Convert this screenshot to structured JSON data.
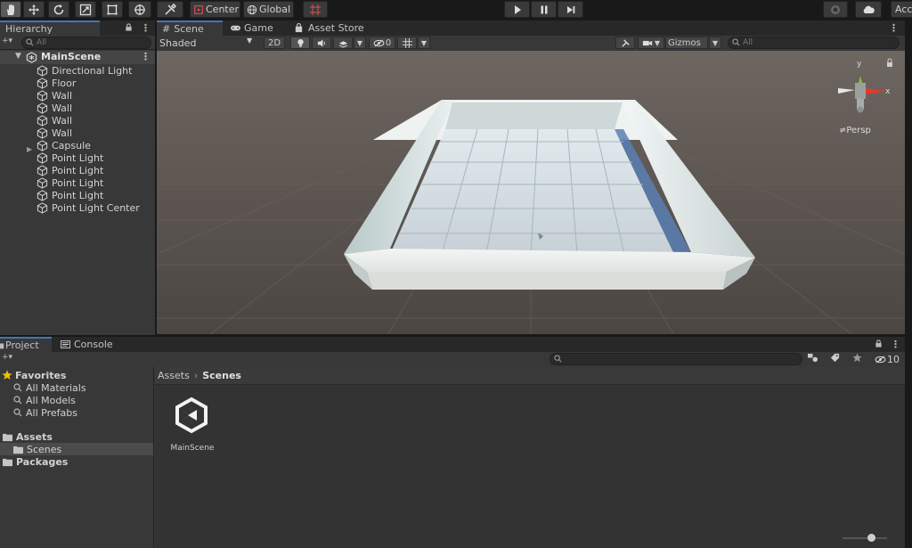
{
  "toolbar": {
    "center_label": "Center",
    "global_label": "Global",
    "account_label": "Acc"
  },
  "hierarchy": {
    "tab_label": "Hierarchy",
    "search_placeholder": "All",
    "scene_name": "MainScene",
    "items": [
      {
        "label": "Directional Light"
      },
      {
        "label": "Floor"
      },
      {
        "label": "Wall"
      },
      {
        "label": "Wall"
      },
      {
        "label": "Wall"
      },
      {
        "label": "Wall"
      },
      {
        "label": "Capsule"
      },
      {
        "label": "Point Light"
      },
      {
        "label": "Point Light"
      },
      {
        "label": "Point Light"
      },
      {
        "label": "Point Light"
      },
      {
        "label": "Point Light Center"
      }
    ]
  },
  "scene_tabs": {
    "scene": "Scene",
    "game": "Game",
    "asset_store": "Asset Store"
  },
  "scene_toolbar": {
    "shading_mode": "Shaded",
    "mode_2d": "2D",
    "hidden_count": "0",
    "gizmos": "Gizmos",
    "search_placeholder": "All"
  },
  "gizmo": {
    "y_label": "y",
    "x_label": "x",
    "persp_label": "≠Persp"
  },
  "project": {
    "tab_project": "Project",
    "tab_console": "Console",
    "favorites_label": "Favorites",
    "favorites": [
      "All Materials",
      "All Models",
      "All Prefabs"
    ],
    "assets_label": "Assets",
    "scenes_label": "Scenes",
    "packages_label": "Packages",
    "breadcrumb_root": "Assets",
    "breadcrumb_current": "Scenes",
    "hidden_packages_count": "10",
    "asset_name": "MainScene"
  },
  "colors": {
    "accent": "#3a79bb",
    "panel_bg": "#383838",
    "scene_bg": "#574f4b"
  }
}
